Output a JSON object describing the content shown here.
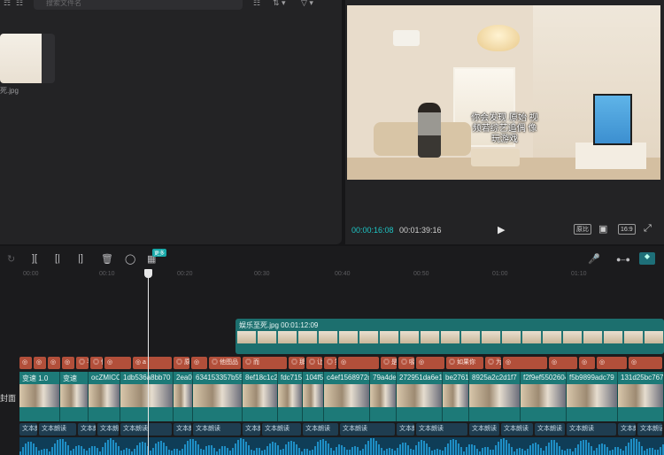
{
  "media": {
    "search_placeholder": "搜索文件名",
    "toolbar_left": "☶",
    "toolbar_a": "☷",
    "toolbar_b": "⇅ ▾",
    "toolbar_c": "▽ ▾",
    "filename": "死.jpg"
  },
  "preview": {
    "subtitle": "你会发现 原始 视频若综艺追偶 像玩游戏",
    "time_current": "00:00:16:08",
    "time_total": "00:01:39:16",
    "btn_original": "原比",
    "btn_ratio": "16:9"
  },
  "timeline": {
    "tooltip": "更多",
    "ticks": [
      "00:00",
      "00:10",
      "00:20",
      "00:30",
      "00:40",
      "00:50",
      "01:00",
      "01:10"
    ],
    "overlay_label": "娱乐至死.jpg  00:01:12:09",
    "cover_label": "封面",
    "stickers": [
      "",
      "",
      "",
      "",
      "平",
      "你会发现",
      "",
      "a",
      "原",
      "",
      "他图品",
      "而",
      "那",
      "让",
      "笑三",
      "",
      "是",
      "吸引",
      "",
      "如果你",
      "为什么"
    ],
    "main_clips": [
      "变速 1.0",
      "变速",
      "ocZMICC",
      "1db536a8bb70",
      "2ea0",
      "634153357b55",
      "8ef18c1c2",
      "fdc715",
      "104f5",
      "c4ef1568972c",
      "79a4de",
      "272951da6e1",
      "be2761",
      "8925a2c2d1f7",
      "f2f9ef5502604",
      "f5b9899adc79",
      "131d25bc7670"
    ],
    "text_clip_label": "文本朗读"
  }
}
